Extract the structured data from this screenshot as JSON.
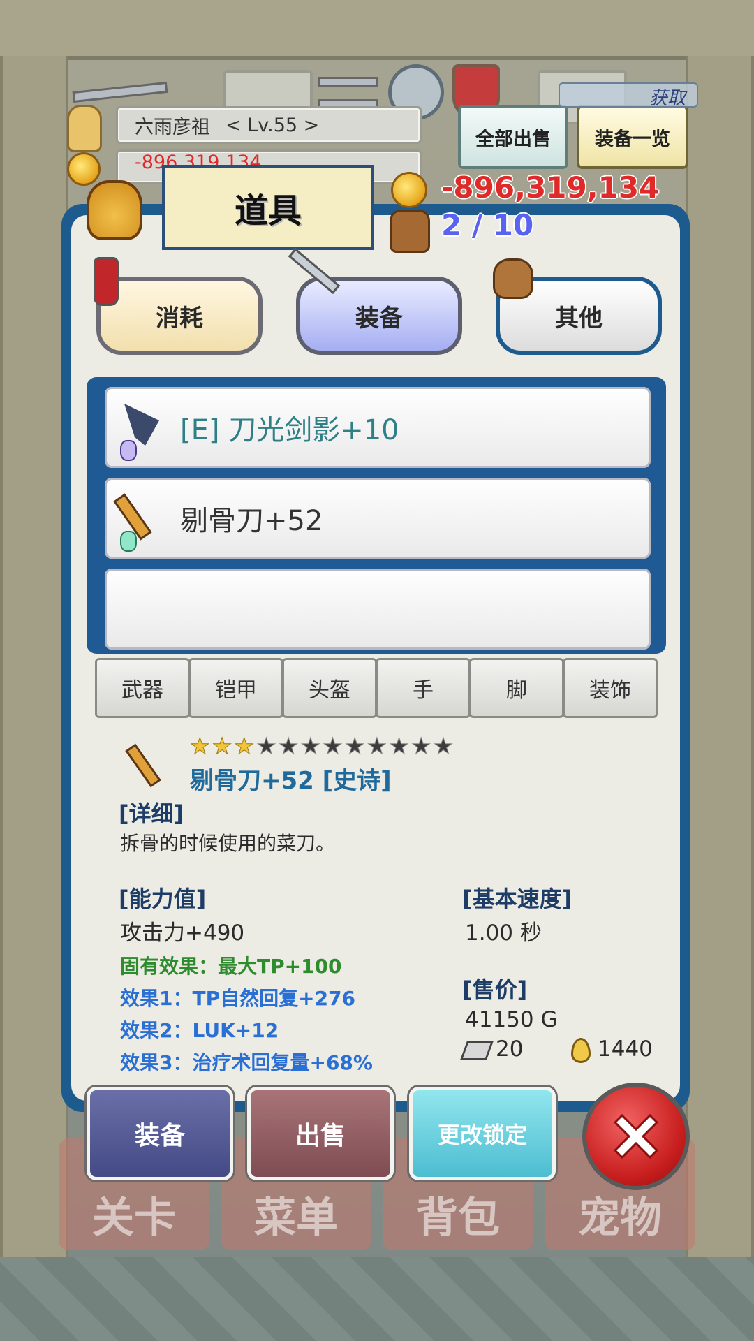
{
  "header": {
    "player_name": "六雨彦祖",
    "player_level": "< Lv.55 >",
    "player_gold_behind": "-896,319,134",
    "sell_all_label": "全部出售",
    "equip_list_label": "装备一览",
    "obtain_label": "获取"
  },
  "panel": {
    "title": "道具",
    "gold": "-896,319,134",
    "bag_count": "2 / 10"
  },
  "category_tabs": [
    {
      "label": "消耗",
      "icon": "potion-icon"
    },
    {
      "label": "装备",
      "icon": "sword-icon",
      "selected": true
    },
    {
      "label": "其他",
      "icon": "pouch-icon"
    }
  ],
  "items": [
    {
      "name": "[E] 刀光剑影+10",
      "equipped": true,
      "icon": "blade-icon",
      "color": "#2f7f86"
    },
    {
      "name": "剔骨刀+52",
      "equipped": false,
      "icon": "knife-icon",
      "color": "#333333"
    },
    {
      "name": "",
      "empty": true
    }
  ],
  "filter_tabs": [
    "武器",
    "铠甲",
    "头盔",
    "手",
    "脚",
    "装饰"
  ],
  "detail": {
    "stars_filled": 3,
    "stars_total": 12,
    "item_title": "剔骨刀+52 [史诗]",
    "desc_label": "[详细]",
    "desc_text": "拆骨的时候使用的菜刀。",
    "stats_label": "[能力值]",
    "attack": "攻击力+490",
    "inherent_effect": "固有效果：最大TP+100",
    "effect1": "效果1：TP自然回复+276",
    "effect2": "效果2：LUK+12",
    "effect3": "效果3：治疗术回复量+68%",
    "speed_label": "[基本速度]",
    "speed_value": "1.00 秒",
    "price_label": "[售价]",
    "price_value": "41150 G",
    "material_count": "20",
    "gem_count": "1440"
  },
  "actions": {
    "equip": "装备",
    "sell": "出售",
    "change_lock": "更改锁定"
  },
  "bottom_nav": [
    "关卡",
    "菜单",
    "背包",
    "宠物"
  ],
  "colors": {
    "panel_border": "#1d5a8e",
    "gold_text": "#e02a2a",
    "bag_text": "#5a63f0",
    "title_blue": "#1f6a9a",
    "inherent_green": "#2e8b2e",
    "effect_blue": "#2a6fd4"
  }
}
